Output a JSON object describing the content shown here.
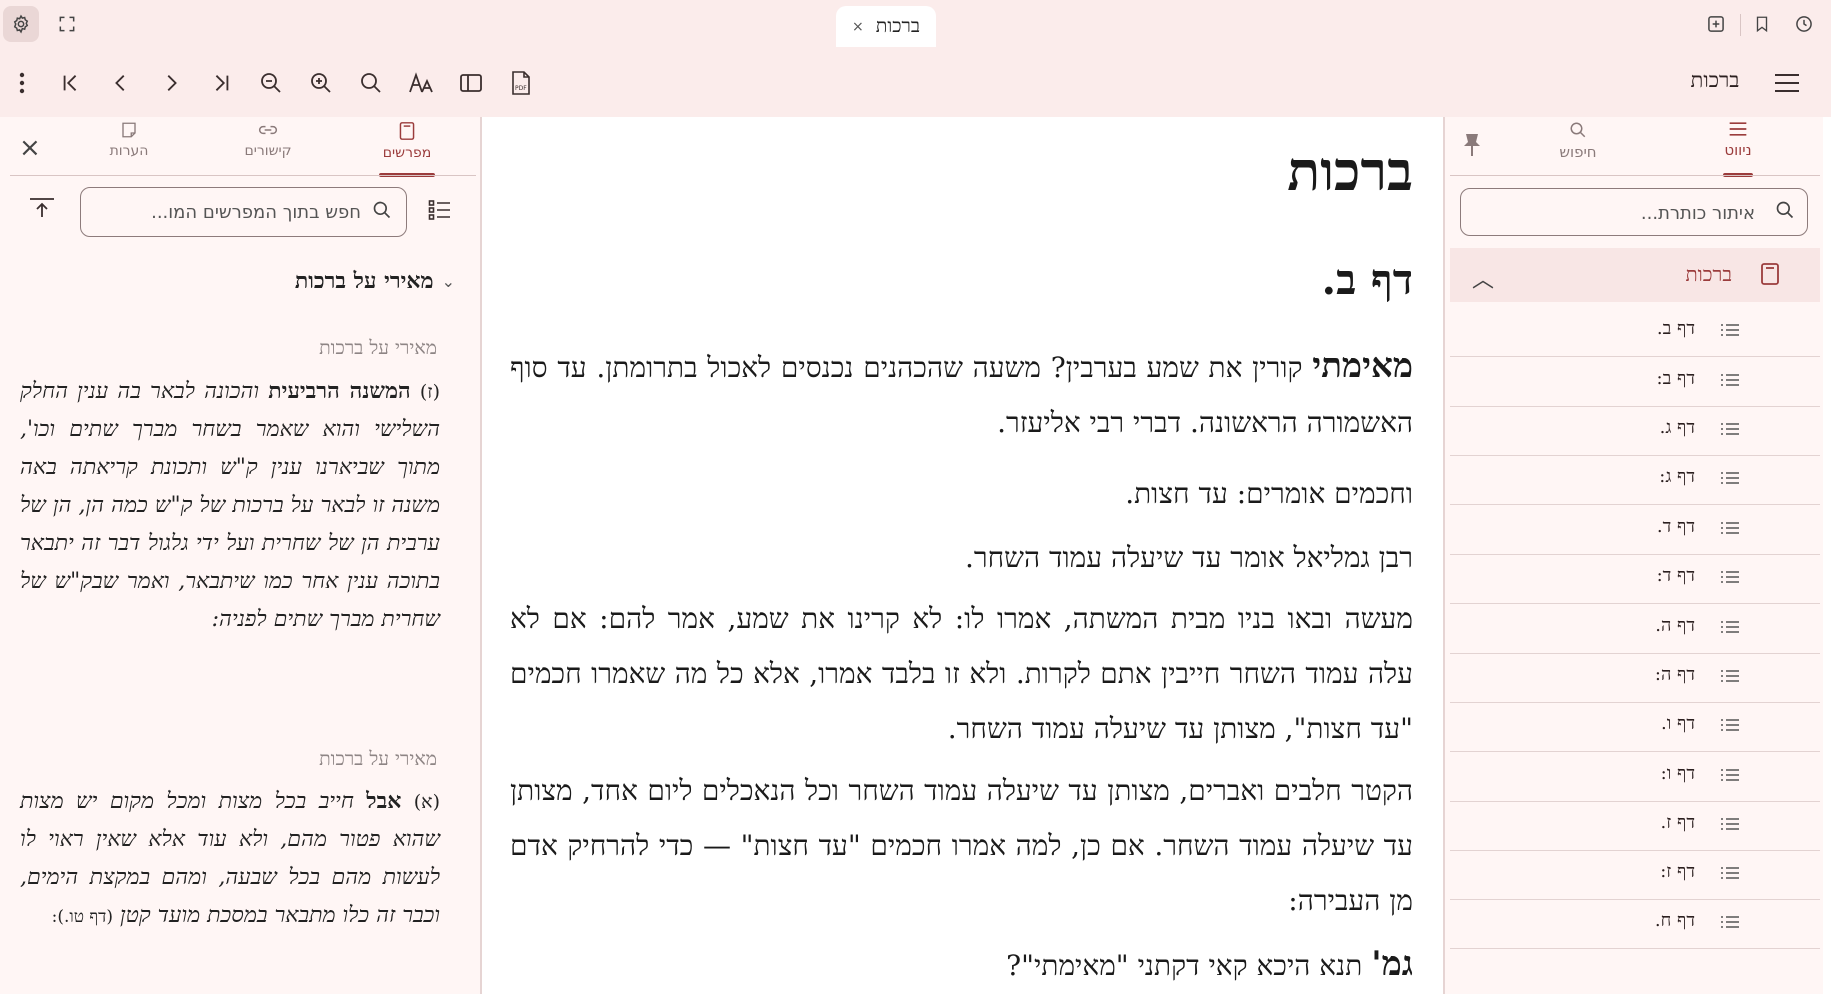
{
  "tab": {
    "title": "ברכות",
    "close": "×"
  },
  "toolbar": {
    "title": "ברכות"
  },
  "commentary": {
    "tabs": [
      {
        "label": "מפרשים"
      },
      {
        "label": "קישורים"
      },
      {
        "label": "הערות"
      }
    ],
    "close": "×",
    "search_placeholder": "חפש בתוך המפרשים המו...",
    "group_title": "מאירי על ברכות",
    "group_chevron": "⌄",
    "entries": [
      {
        "source": "מאירי על ברכות",
        "marker": "(ז)",
        "bold": "המשנה הרביעית",
        "text": "והכונה לבאר בה ענין החלק השלישי והוא שאמר בשחר מברך שתים וכו', מתוך שביארנו ענין ק\"ש ותכונת קריאתה באה משנה זו לבאר על ברכות של ק\"ש כמה הן, הן של ערבית הן של שחרית ועל ידי גלגול דבר זה יתבאר בתוכה ענין אחר כמו שיתבאר, ואמר שבק\"ש של שחרית מברך שתים לפניה:"
      },
      {
        "source": "מאירי על ברכות",
        "marker": "(א)",
        "bold": "אבל",
        "text": "חייב בכל מצות ומכל מקום יש מצות שהוא פטור מהם, ולא עוד אלא שאין ראוי לו לעשות מהם בכל שבעה, ומהם במקצת הימים, וכבר זה כלו מתבאר במסכת מועד קטן",
        "ref": "(דף טו.):"
      }
    ]
  },
  "main": {
    "title": "ברכות",
    "daf": "דף ב.",
    "paragraphs": [
      {
        "first": "מאימתי",
        "text": "קורין את שמע בערבין? משעה שהכהנים נכנסים לאכול בתרומתן. עד סוף האשמורה הראשונה. דברי רבי אליעזר."
      },
      {
        "text": "וחכמים אומרים: עד חצות."
      },
      {
        "text": "רבן גמליאל אומר עד שיעלה עמוד השחר."
      },
      {
        "text": "מעשה ובאו בניו מבית המשתה, אמרו לו: לא קרינו את שמע, אמר להם: אם לא עלה עמוד השחר חייבין אתם לקרות. ולא זו בלבד אמרו, אלא כל מה שאמרו חכמים \"עד חצות\", מצותן עד שיעלה עמוד השחר."
      },
      {
        "text": "הקטר חלבים ואברים, מצותן עד שיעלה עמוד השחר וכל הנאכלים ליום אחד, מצותן עד שיעלה עמוד השחר. אם כן, למה אמרו חכמים \"עד חצות\" — כדי להרחיק אדם מן העבירה:"
      },
      {
        "first": "גמ'",
        "text": "תנא היכא קאי דקתני \"מאימתי\"?"
      }
    ]
  },
  "nav": {
    "tabs": [
      {
        "label": "ניווט"
      },
      {
        "label": "חיפוש"
      }
    ],
    "search_placeholder": "איתור כותרת...",
    "book": "ברכות",
    "book_chevron": "︿",
    "items": [
      "דף ב.",
      "דף ב:",
      "דף ג.",
      "דף ג:",
      "דף ד.",
      "דף ד:",
      "דף ה.",
      "דף ה:",
      "דף ו.",
      "דף ו:",
      "דף ז.",
      "דף ז:",
      "דף ח."
    ]
  }
}
